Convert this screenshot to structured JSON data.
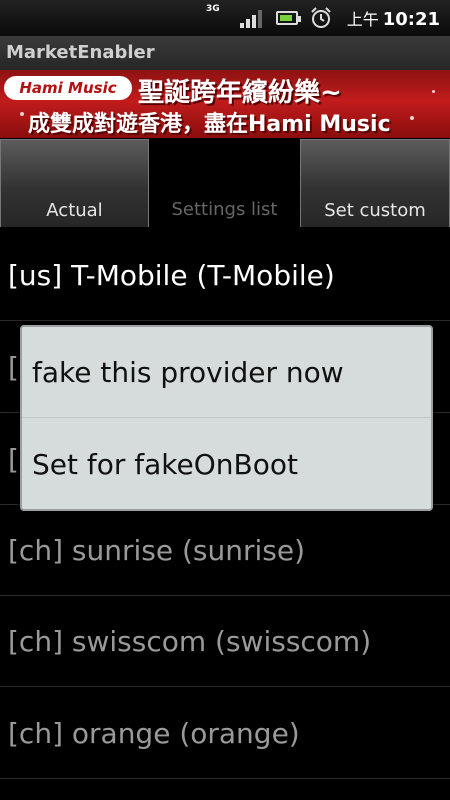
{
  "statusbar": {
    "network_type": "3G",
    "clock_ampm": "上午",
    "clock_time": "10:21"
  },
  "app": {
    "title": "MarketEnabler"
  },
  "banner": {
    "brand": "Hami Music",
    "headline": "聖誕跨年繽紛樂~",
    "subline": "成雙成對遊香港，盡在Hami Music"
  },
  "tabs": [
    {
      "label": "Actual",
      "selected": false
    },
    {
      "label": "Settings list",
      "selected": true
    },
    {
      "label": "Set custom",
      "selected": false
    }
  ],
  "list": {
    "items": [
      "[us] T-Mobile (T-Mobile)",
      "[",
      "[",
      "[ch] sunrise (sunrise)",
      "[ch] swisscom (swisscom)",
      "[ch] orange (orange)"
    ]
  },
  "dialog": {
    "options": [
      "fake this provider now",
      "Set for fakeOnBoot"
    ]
  },
  "colors": {
    "status_bg": "#111111",
    "title_bg": "#2e2e2e",
    "banner_red": "#c21c1c",
    "dialog_bg": "#d6dcdb",
    "battery_green": "#7ad33b"
  }
}
